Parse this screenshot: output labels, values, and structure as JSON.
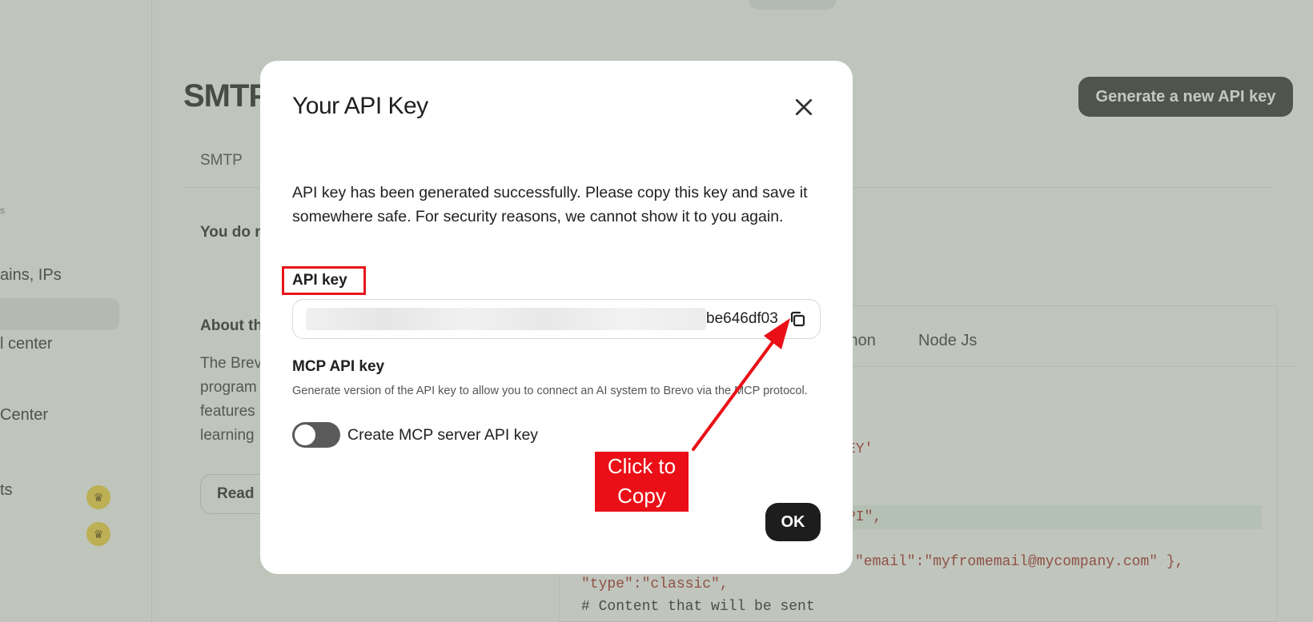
{
  "background": {
    "sidebar": {
      "small_label": "s",
      "items": [
        {
          "label": "ains, IPs"
        },
        {
          "label": "l center"
        },
        {
          "label": "Center"
        },
        {
          "label": "ts"
        }
      ]
    },
    "page_title": "SMTP",
    "generate_button": "Generate a new API key",
    "tab_label": "SMTP",
    "notice_text": "You do r",
    "about_heading": "About th",
    "paragraph_lines": [
      "The Brev",
      "program",
      "features",
      "learning"
    ],
    "read_button": "Read",
    "code_tabs": [
      "thon",
      "Node Js"
    ],
    "code_lines": [
      {
        "text": "EY'",
        "kind": "string"
      },
      {
        "text": "PI\",",
        "kind": "string"
      },
      {
        "text": "\"email\":\"myfromemail@mycompany.com\" },",
        "kind": "mixed"
      },
      {
        "text": "\"type\":\"classic\",",
        "kind": "mixed"
      },
      {
        "text": "# Content that will be sent",
        "kind": "comment"
      }
    ]
  },
  "modal": {
    "title": "Your API Key",
    "description": "API key has been generated successfully. Please copy this key and save it somewhere safe. For security reasons, we cannot show it to you again.",
    "api_key_label": "API key",
    "api_key_visible_suffix": "be646df03",
    "mcp_title": "MCP API key",
    "mcp_description": "Generate version of the API key to allow you to connect an AI system to Brevo via the MCP protocol.",
    "toggle_label": "Create MCP server API key",
    "toggle_on": false,
    "ok_button": "OK"
  },
  "annotation": {
    "callout_text": "Click to Copy",
    "color": "#ea0f16"
  },
  "icons": {
    "close": "close-icon",
    "copy": "copy-icon",
    "crown": "crown-icon"
  }
}
